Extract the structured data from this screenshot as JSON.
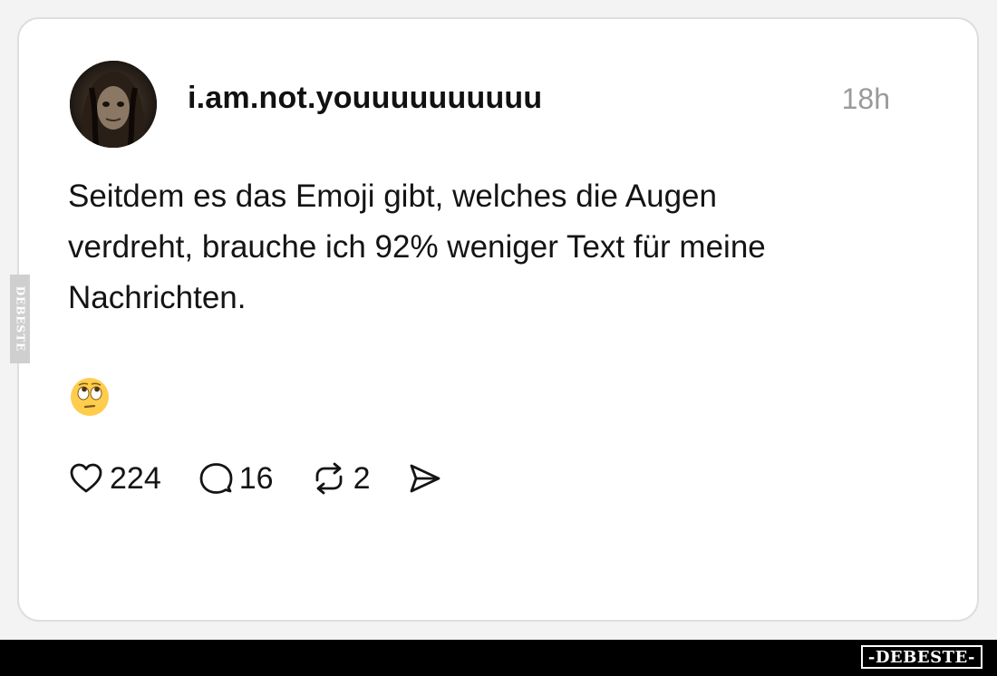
{
  "post": {
    "username": "i.am.not.youuuuuuuuuu",
    "timestamp": "18h",
    "text_lines": [
      "Seitdem es das Emoji gibt, welches die Augen",
      "verdreht, brauche ich 92% weniger Text für meine",
      "Nachrichten."
    ],
    "emoji": "face-with-rolling-eyes"
  },
  "actions": {
    "likes": "224",
    "comments": "16",
    "reposts": "2",
    "share_icon": "send-icon"
  },
  "watermark": {
    "side": "DEBESTE",
    "bottom": "-DEBESTE-"
  },
  "colors": {
    "background": "#f3f3f3",
    "card": "#ffffff",
    "text": "#141414",
    "timestamp": "#9a9a9a",
    "bottom_bar": "#000000",
    "emoji_face": "#ffcc4d"
  }
}
